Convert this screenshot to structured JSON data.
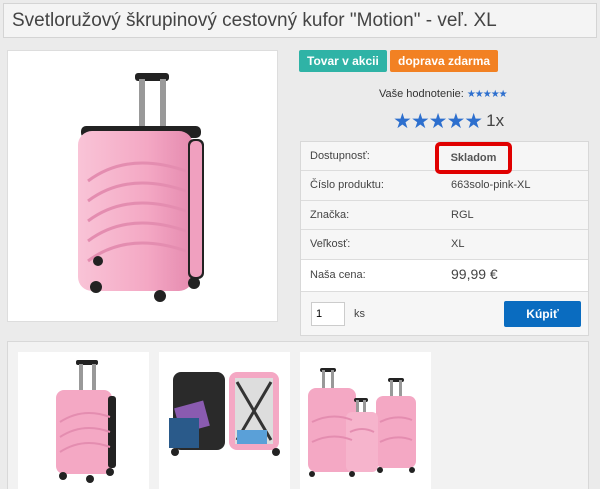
{
  "product": {
    "title": "Svetlоružový škrupinový cestovný kufor \"Motion\" - veľ. XL"
  },
  "badges": {
    "sale": "Tovar v akcii",
    "shipping": "doprava zdarma"
  },
  "rating": {
    "label": "Vaše hodnotenie:",
    "small_stars": "★★★★★",
    "big_stars": "★★★★★",
    "count": "1x"
  },
  "details": {
    "availability_label": "Dostupnosť:",
    "availability_value": "Skladom",
    "code_label": "Číslo produktu:",
    "code_value": "663solo-pink-XL",
    "brand_label": "Značka:",
    "brand_value": "RGL",
    "size_label": "Veľkosť:",
    "size_value": "XL",
    "price_label": "Naša cena:",
    "price_value": "99,99 €"
  },
  "cart": {
    "quantity": "1",
    "unit": "ks",
    "buy_label": "Kúpiť"
  },
  "colors": {
    "accent_blue": "#0a6cc0",
    "sale_teal": "#2fb3a6",
    "shipping_orange": "#f28123",
    "highlight_red": "#e00000",
    "suitcase_pink": "#f4a8c4"
  }
}
